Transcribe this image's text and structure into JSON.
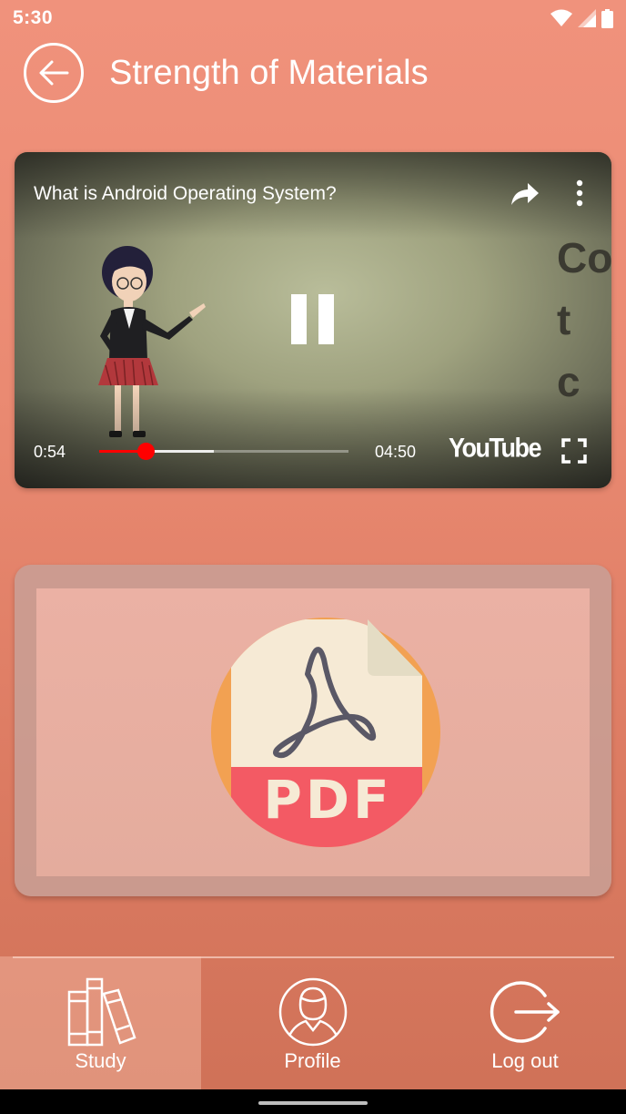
{
  "status_bar": {
    "time": "5:30",
    "icons": [
      "wifi-icon",
      "signal-icon",
      "battery-icon"
    ]
  },
  "header": {
    "title": "Strength of Materials",
    "back_icon": "arrow-left-icon"
  },
  "video": {
    "title": "What is Android Operating System?",
    "current_time": "0:54",
    "duration": "04:50",
    "played_fraction": 0.186,
    "buffered_fraction": 0.46,
    "brand": "YouTube",
    "background_text": "Co\nt\nc",
    "state": "playing",
    "icons": [
      "share-icon",
      "more-vert-icon",
      "pause-icon",
      "fullscreen-icon"
    ]
  },
  "pdf_card": {
    "label": "PDF",
    "icon": "pdf-file-icon",
    "colors": {
      "circle": "#f2a152",
      "page": "#f6ead5",
      "fold": "#e4dcc4",
      "band": "#f35a64",
      "logo": "#5a5866"
    }
  },
  "bottom_nav": {
    "items": [
      {
        "label": "Study",
        "icon": "books-icon",
        "active": true
      },
      {
        "label": "Profile",
        "icon": "user-circle-icon",
        "active": false
      },
      {
        "label": "Log out",
        "icon": "logout-icon",
        "active": false
      }
    ]
  },
  "colors": {
    "background_top": "#f0927c",
    "background_bottom": "#cf7157",
    "progress_played": "#ff0000"
  }
}
